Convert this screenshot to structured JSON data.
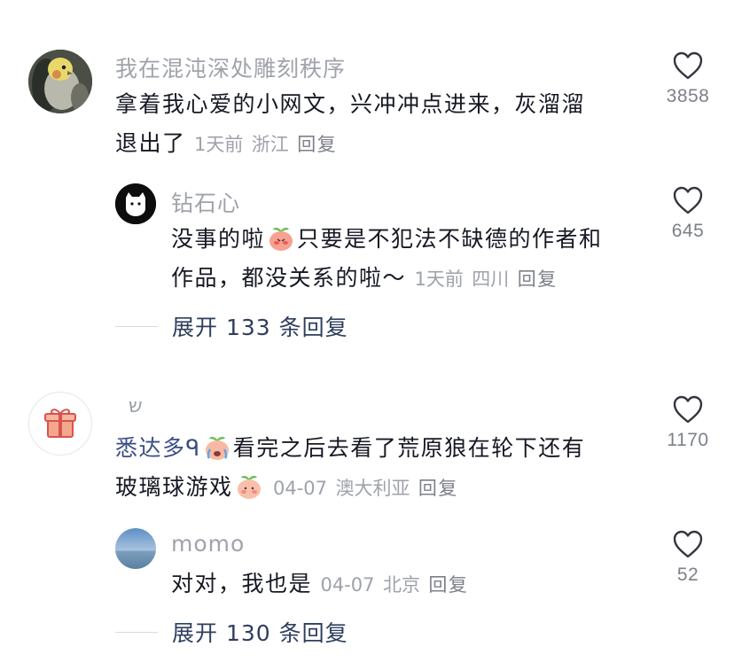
{
  "comments": [
    {
      "username": "我在混沌深处雕刻秩序",
      "text_line1": "拿着我心爱的小网文，兴冲冲点进来，灰溜溜",
      "text_line2": "退出了",
      "time": "1天前",
      "location": "浙江",
      "reply_label": "回复",
      "likes": "3858",
      "replies": [
        {
          "username": "钻石心",
          "text_a": "没事的啦",
          "text_b": "只要是不犯法不缺德的作者和",
          "text_line2": "作品，都没关系的啦～",
          "time": "1天前",
          "location": "四川",
          "reply_label": "回复",
          "likes": "645"
        }
      ],
      "expand_label": "展开 133 条回复"
    },
    {
      "username": "ש",
      "mention": "悉达多ᑫ",
      "text_a": "看完之后去看了荒原狼在轮下还有",
      "text_line2": "玻璃球游戏",
      "time": "04-07",
      "location": "澳大利亚",
      "reply_label": "回复",
      "likes": "1170",
      "replies": [
        {
          "username": "momo",
          "text": "对对，我也是",
          "time": "04-07",
          "location": "北京",
          "reply_label": "回复",
          "likes": "52"
        }
      ],
      "expand_label": "展开 130 条回复"
    }
  ],
  "icons": {
    "like": "heart-outline-icon",
    "gift": "gift-icon"
  },
  "colors": {
    "name": "#a0a3ab",
    "text": "#161823",
    "meta": "#9fa2aa",
    "expand": "#2f3e5e",
    "mention": "#3a4e86"
  }
}
